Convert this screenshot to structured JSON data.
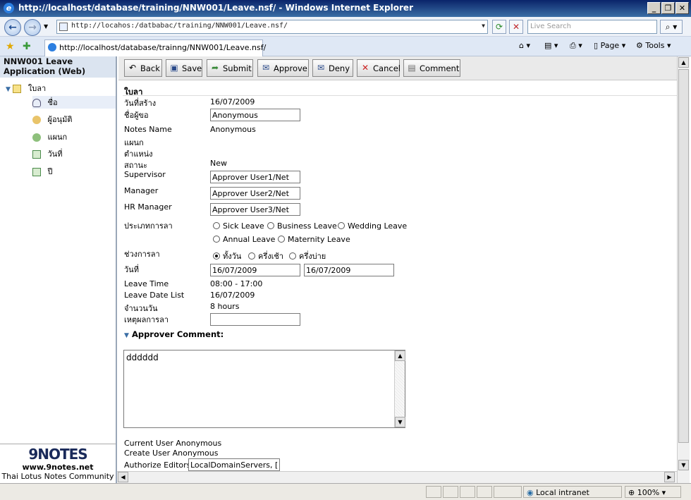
{
  "window": {
    "title": "http://localhost/database/training/NNW001/Leave.nsf/ - Windows Internet Explorer"
  },
  "browser": {
    "address": "http://locahos:/datbabac/training/NNW001/Leave.nsf/",
    "search_placeholder": "Live Search",
    "tab_title": "http://localhost/database/trainng/NNW001/Leave.nsf/",
    "tools": {
      "page": "Page",
      "tools": "Tools"
    }
  },
  "sidebar": {
    "app_title": "NNW001 Leave Application (Web)",
    "root": "ใบลา",
    "items": [
      {
        "label": "ชื่อ",
        "icon": "person-icon"
      },
      {
        "label": "ผู้อนุมัติ",
        "icon": "approver-icon"
      },
      {
        "label": "แผนก",
        "icon": "group-icon"
      },
      {
        "label": "วันที่",
        "icon": "calendar-icon"
      },
      {
        "label": "ปี",
        "icon": "calendar-icon"
      }
    ],
    "logo": {
      "brand": "9NOTES",
      "url": "www.9notes.net",
      "tagline": "Thai Lotus Notes Community"
    }
  },
  "actions": [
    {
      "label": "Back",
      "icon": "back-icon"
    },
    {
      "label": "Save",
      "icon": "save-icon"
    },
    {
      "label": "Submit",
      "icon": "submit-icon"
    },
    {
      "label": "Approve",
      "icon": "approve-icon"
    },
    {
      "label": "Deny",
      "icon": "deny-icon"
    },
    {
      "label": "Cancel",
      "icon": "cancel-icon"
    },
    {
      "label": "Comment",
      "icon": "comment-icon"
    }
  ],
  "form": {
    "section_title": "ใบลา",
    "created_label": "วันที่สร้าง",
    "created_value": "16/07/2009",
    "requester_label": "ชื่อผู้ขอ",
    "requester_value": "Anonymous",
    "notes_name_label": "Notes Name",
    "notes_name_value": "Anonymous",
    "department_label": "แผนก",
    "position_label": "ตำแหน่ง",
    "status_label": "สถานะ",
    "status_value": "New",
    "supervisor_label": "Supervisor",
    "supervisor_value": "Approver User1/Net",
    "manager_label": "Manager",
    "manager_value": "Approver User2/Net",
    "hr_manager_label": "HR Manager",
    "hr_manager_value": "Approver User3/Net",
    "leave_type_label": "ประเภทการลา",
    "leave_types": [
      "Sick Leave",
      "Business Leave",
      "Wedding Leave",
      "Annual Leave",
      "Maternity Leave"
    ],
    "period_label": "ช่วงการลา",
    "periods": [
      "ทั้งวัน",
      "ครึ่งเช้า",
      "ครึ่งบ่าย"
    ],
    "period_selected": "ทั้งวัน",
    "date_label": "วันที่",
    "date_from": "16/07/2009",
    "date_to": "16/07/2009",
    "leave_time_label": "Leave Time",
    "leave_time_value": "08:00 - 17:00",
    "leave_date_list_label": "Leave Date List",
    "leave_date_list_value": "16/07/2009",
    "days_label": "จำนวนวัน",
    "days_value": "8 hours",
    "reason_label": "เหตุผลการลา",
    "reason_value": "",
    "approver_comment_label": "Approver Comment:",
    "comment_text": "dddddd",
    "current_user": "Current User Anonymous",
    "create_user": "Create User Anonymous",
    "authorize_label": "Authorize Editors",
    "authorize_value": "LocalDomainServers, ["
  },
  "status": {
    "zone": "Local intranet",
    "zoom": "100%"
  }
}
